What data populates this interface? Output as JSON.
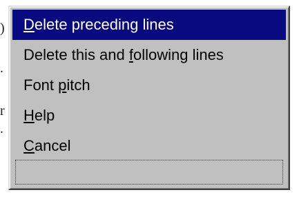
{
  "menu": {
    "items": [
      {
        "pre": "",
        "key": "D",
        "post": "elete preceding lines",
        "selected": true
      },
      {
        "pre": "Delete this and ",
        "key": "f",
        "post": "ollowing lines",
        "selected": false
      },
      {
        "pre": "Font ",
        "key": "p",
        "post": "itch",
        "selected": false
      },
      {
        "pre": "",
        "key": "H",
        "post": "elp",
        "selected": false
      },
      {
        "pre": "",
        "key": "C",
        "post": "ancel",
        "selected": false
      }
    ],
    "status_text": ""
  },
  "backdrop": {
    "glyphs": [
      ")",
      ".",
      "r",
      "."
    ]
  },
  "colors": {
    "menu_background": "#c0c0c0",
    "selection_background": "#0a0a80",
    "selection_text": "#ffffff",
    "menu_text": "#000000"
  }
}
